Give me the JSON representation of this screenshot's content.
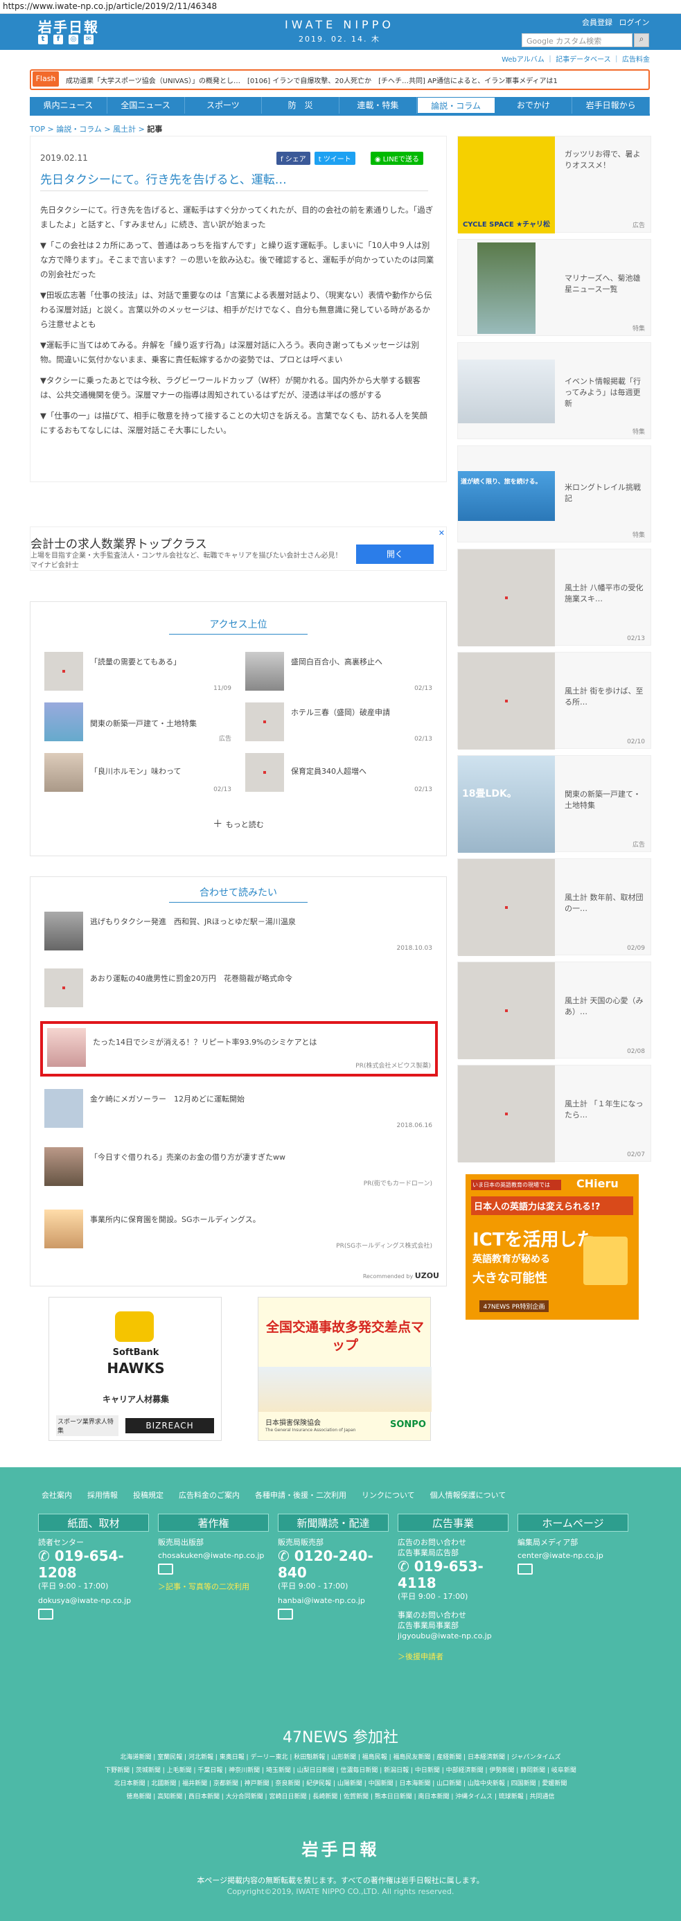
{
  "url": "https://www.iwate-np.co.jp/article/2019/2/11/46348",
  "header": {
    "logo": "岩手日報",
    "center_title": "IWATE NIPPO",
    "date": "2019. 02. 14. 木",
    "member_register": "会員登録",
    "login": "ログイン",
    "search_placeholder": "Google カスタム検索",
    "sub_links": [
      "Webアルバム",
      "記事データベース",
      "広告料金"
    ]
  },
  "flash": {
    "tag": "Flash",
    "text": "成功道果「大学スポーツ協会（UNIVAS）」の概発とし…　[0106] イランで自爆攻撃、20人死亡か　[チヘチ…共同] AP通信によると、イラン軍事メディアは1"
  },
  "nav": {
    "items": [
      "県内ニュース",
      "全国ニュース",
      "スポーツ",
      "防　災",
      "連載・特集",
      "論説・コラム",
      "おでかけ",
      "岩手日報から"
    ],
    "active_index": 5
  },
  "breadcrumb": [
    "TOP",
    "論説・コラム",
    "風土計",
    "記事"
  ],
  "article": {
    "date": "2019.02.11",
    "share_fb": "シェア",
    "share_tw": "ツイート",
    "share_line": "LINEで送る",
    "title": "先日タクシーにて。行き先を告げると、運転…",
    "paragraphs": [
      "先日タクシーにて。行き先を告げると、運転手はすぐ分かってくれたが、目的の会社の前を素通りした。「過ぎましたよ」と話すと、「すみません」に続き、言い訳が始まった",
      "▼「この会社は２カ所にあって、普通はあっちを指すんです」と繰り返す運転手。しまいに「10人中９人は別な方で降ります」。そこまで言います？－の思いを飲み込む。後で確認すると、運転手が向かっていたのは同業の別会社だった",
      "▼田坂広志著「仕事の技法」は、対話で重要なのは「言葉による表層対話より、（現実ない）表情や動作から伝わる深層対話」と説く。言葉以外のメッセージは、相手がだけでなく、自分も無意識に発している時があるから注意せよとも",
      "▼運転手に当てはめてみる。弁解を「繰り返す行為」は深層対話に入ろう。表向き謝ってもメッセージは別物。間違いに気付かないまま、乗客に責任転嫁するかの姿勢では、プロとは呼べまい",
      "▼タクシーに乗ったあとでは今秋、ラグビーワールドカップ（W杯）が開かれる。国内外から大挙する観客は、公共交通機関を使う。深層マナーの指導は周知されているはずだが、浸透は半ばの感がする",
      "▼「仕事の一」は描びて、相手に敬意を持って接することの大切さを訴える。言葉でなくも、訪れる人を笑顔にするおもてなしには、深層対話こそ大事にしたい。"
    ]
  },
  "ad_banner": {
    "title": "会計士の求人数業界トップクラス",
    "body": "上場を目指す企業・大手監査法人・コンサル会社など、転職でキャリアを描びたい会計士さん必見！マイナビ会計士",
    "button": "開く"
  },
  "access_ranking": {
    "title": "アクセス上位",
    "items": [
      {
        "title": "「読量の需要とてもある」",
        "date": "11/09"
      },
      {
        "title": "盛岡白百合小、高裏移止へ",
        "date": "02/13"
      },
      {
        "title": "関東の新築一戸建て・土地特集",
        "date": "広告"
      },
      {
        "title": "ホテル三春（盛岡）破産申請",
        "date": "02/13"
      },
      {
        "title": "「良川ホルモン」味わって",
        "date": "02/13"
      },
      {
        "title": "保育定員340人超増へ",
        "date": "02/13"
      }
    ],
    "more": "もっと読む"
  },
  "related": {
    "title": "合わせて読みたい",
    "items": [
      {
        "title": "逃げもりタクシー発進　西和賀、JRほっとゆだ駅－湯川温泉",
        "meta": "2018.10.03"
      },
      {
        "title": "あおり運転の40歳男性に罰金20万円　花巻簡裁が略式命令",
        "meta": ""
      },
      {
        "title": "たった14日でシミが消える！？リピート率93.9%のシミケアとは",
        "meta": "PR(株式会社メビウス製薬)"
      },
      {
        "title": "金ケ崎にメガソーラー　12月めどに運転開始",
        "meta": "2018.06.16"
      },
      {
        "title": "「今日すぐ借りれる」売楽のお金の借り方が凄すぎたww",
        "meta": "PR(街でもカードローン)"
      },
      {
        "title": "事業所内に保育園を開設。SGホールディングス。",
        "meta": "PR(SGホールディングス株式会社)"
      }
    ],
    "recommended_by": "Recommended by",
    "brand": "UZOU"
  },
  "bottom_ads": {
    "left": {
      "team": "SoftBank",
      "name": "HAWKS",
      "sub": "キャリア人材募集",
      "tag": "スポーツ業界求人特集",
      "brand": "BIZREACH"
    },
    "right": {
      "title": "全国交通事故多発交差点マップ",
      "org": "日本損害保険協会",
      "org_en": "The General Insurance Association of Japan",
      "brand": "SONPO"
    }
  },
  "sidebar": {
    "items": [
      {
        "title": "ガッツリお得で、暑よりオススメ！",
        "date": "広告",
        "label": "CYCLE SPACE ★チャリ松"
      },
      {
        "title": "マリナーズへ、菊池雄星ニュース一覧",
        "date": "特集"
      },
      {
        "title": "イベント情報掲載「行ってみよう」は毎週更新",
        "date": "特集"
      },
      {
        "title": "米ロングトレイル挑戦記",
        "date": "特集",
        "label": "道が続く限り、旅を続ける。"
      },
      {
        "title": "風土計 八幡平市の受化施業スキ…",
        "date": "02/13"
      },
      {
        "title": "風土計 街を歩けば、至る所…",
        "date": "02/10"
      },
      {
        "title": "関東の新築一戸建て・土地特集",
        "date": "広告",
        "label": "18畳LDK。"
      },
      {
        "title": "風土計 数年前、取材団の一…",
        "date": "02/09"
      },
      {
        "title": "風土計 天国の心愛（みあ）…",
        "date": "02/08"
      },
      {
        "title": "風土計 「１年生になったら…",
        "date": "02/07"
      }
    ],
    "ad": {
      "top": "いま日本の英語教育の現場では",
      "title": "日本人の英語力は変えられる!?",
      "main1": "ICTを活用した",
      "main2": "英語教育が秘める",
      "main3": "大きな可能性",
      "foot": "47NEWS PR特別企画",
      "brand": "CHieru"
    }
  },
  "footer": {
    "links": [
      "会社案内",
      "採用情報",
      "投稿規定",
      "広告料金のご案内",
      "各種申請・後援・二次利用",
      "リンクについて",
      "個人情報保護について"
    ],
    "columns": [
      {
        "head": "紙面、取材",
        "lines": [
          "読者センター"
        ],
        "phone": "019-654-1208",
        "hours": "(平日 9:00 - 17:00)",
        "email": "dokusya@iwate-np.co.jp",
        "link": ""
      },
      {
        "head": "著作権",
        "lines": [
          "販売局出版部"
        ],
        "phone": "",
        "hours": "",
        "email": "chosakuken@iwate-np.co.jp",
        "link": "＞記事・写真等の二次利用"
      },
      {
        "head": "新聞購読・配達",
        "lines": [
          "販売局販売部"
        ],
        "phone": "0120-240-840",
        "hours": "(平日 9:00 - 17:00)",
        "email": "hanbai@iwate-np.co.jp",
        "link": ""
      },
      {
        "head": "広告事業",
        "lines": [
          "広告のお問い合わせ",
          "広告事業局広告部"
        ],
        "phone": "019-653-4118",
        "hours": "(平日 9:00 - 17:00)",
        "email": "",
        "link": "＞後援申請者",
        "extra1": "事業のお問い合わせ",
        "extra2": "広告事業局事業部",
        "extra_email": "jigyoubu@iwate-np.co.jp"
      },
      {
        "head": "ホームページ",
        "lines": [
          "編集局メディア部"
        ],
        "phone": "",
        "hours": "",
        "email": "center@iwate-np.co.jp",
        "link": ""
      }
    ],
    "news47_title": "47NEWS 参加社",
    "news47_lines": [
      "北海道新聞 | 室蘭民報 | 河北新報 | 東奥日報 | デーリー東北 | 秋田魁新報 | 山形新聞 | 福島民報 | 福島民友新聞 | 産経新聞 | 日本経済新聞 | ジャパンタイムズ",
      "下野新聞 | 茨城新聞 | 上毛新聞 | 千葉日報 | 神奈川新聞 | 埼玉新聞 | 山梨日日新聞 | 信濃毎日新聞 | 新潟日報 | 中日新聞 | 中部経済新聞 | 伊勢新聞 | 静岡新聞 | 岐阜新聞",
      "北日本新聞 | 北國新聞 | 福井新聞 | 京都新聞 | 神戸新聞 | 奈良新聞 | 紀伊民報 | 山陽新聞 | 中国新聞 | 日本海新聞 | 山口新聞 | 山陰中央新報 | 四国新聞 | 愛媛新聞",
      "徳島新聞 | 高知新聞 | 西日本新聞 | 大分合同新聞 | 宮崎日日新聞 | 長崎新聞 | 佐賀新聞 | 熊本日日新聞 | 南日本新聞 | 沖縄タイムス | 琉球新報 | 共同通信"
    ],
    "logo": "岩手日報",
    "notice": "本ページ掲載内容の無断転載を禁じます。すべての著作権は岩手日報社に属します。",
    "copyright": "Copyright©2019, IWATE NIPPO CO.,LTD. All rights reserved."
  },
  "colors": {
    "brand_blue": "#2b88c7",
    "footer_green": "#4db9a7",
    "flash_orange": "#f26a2b",
    "highlight_red": "#e0161b"
  }
}
